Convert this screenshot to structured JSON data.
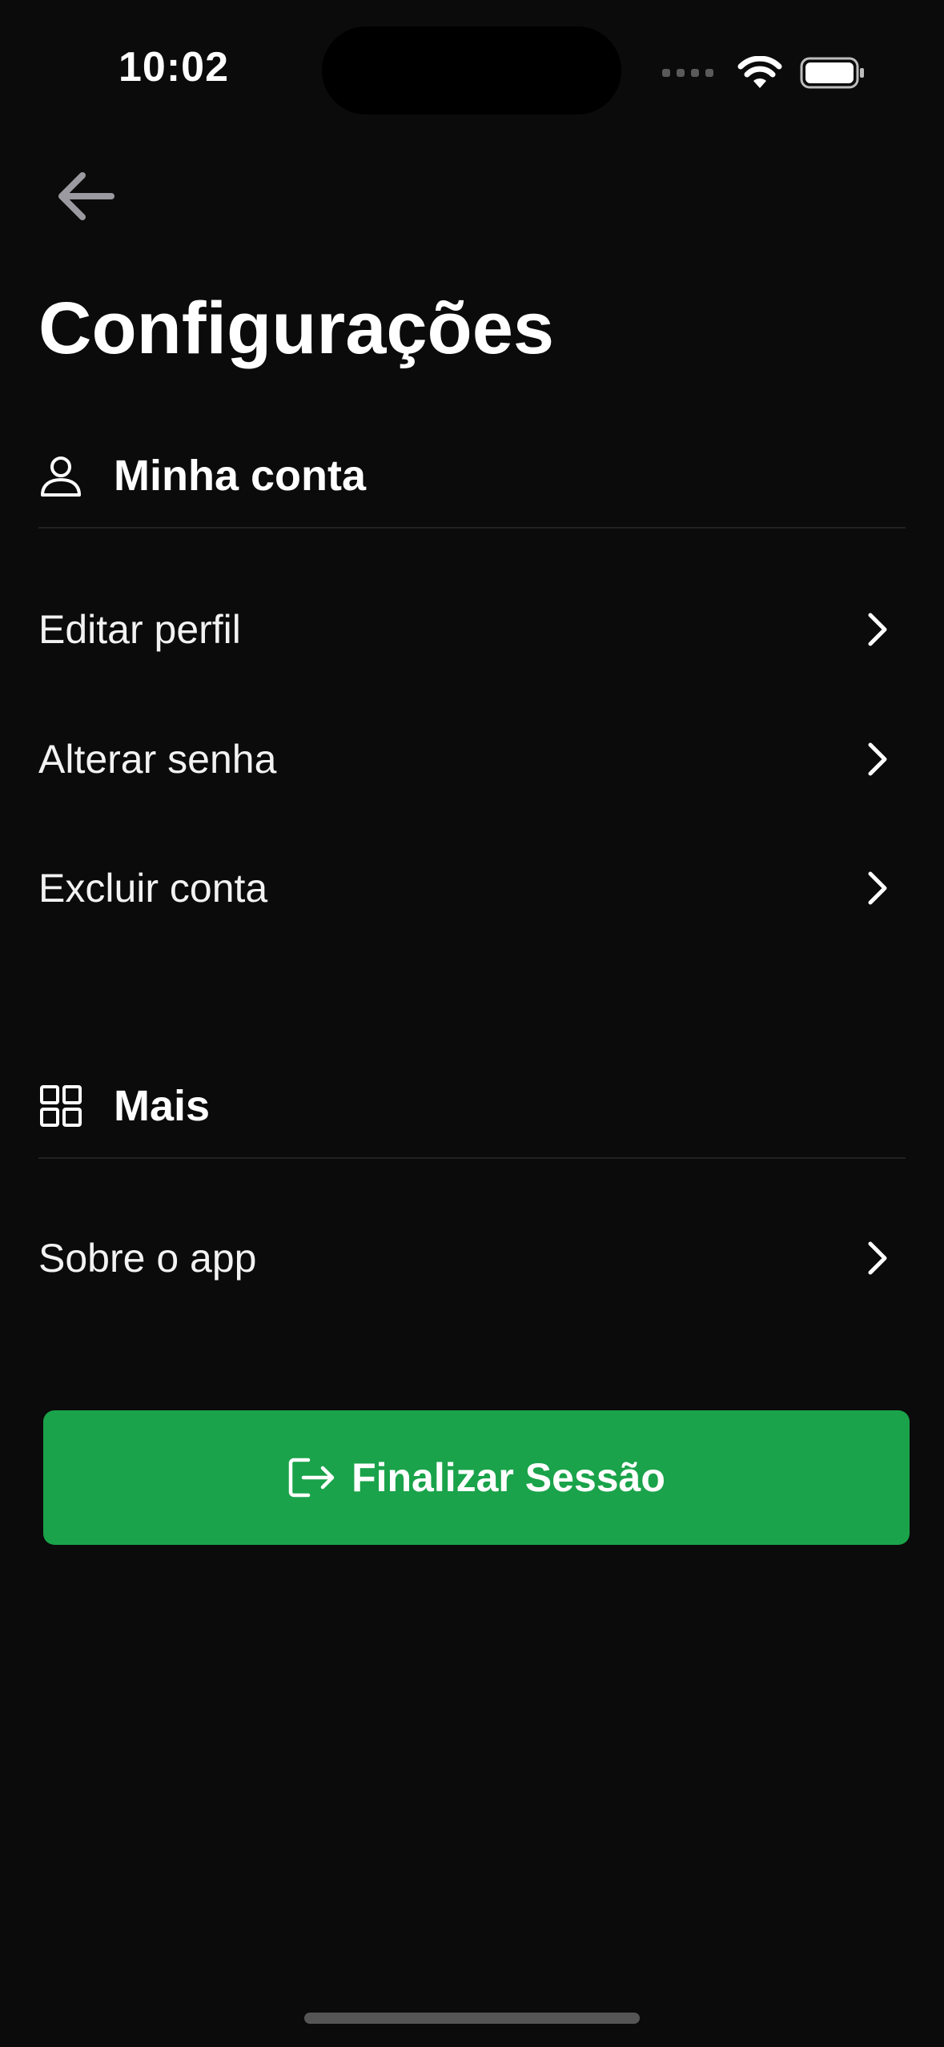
{
  "status_bar": {
    "time": "10:02",
    "icons": [
      "cellular-signal-icon",
      "wifi-icon",
      "battery-icon"
    ]
  },
  "header": {
    "back_icon": "arrow-left-icon",
    "title": "Configurações"
  },
  "sections": [
    {
      "icon": "user-icon",
      "title": "Minha conta",
      "items": [
        {
          "label": "Editar perfil",
          "icon": "chevron-right-icon"
        },
        {
          "label": "Alterar senha",
          "icon": "chevron-right-icon"
        },
        {
          "label": "Excluir conta",
          "icon": "chevron-right-icon"
        }
      ]
    },
    {
      "icon": "grid-icon",
      "title": "Mais",
      "items": [
        {
          "label": "Sobre o app",
          "icon": "chevron-right-icon"
        }
      ]
    }
  ],
  "logout_button": {
    "label": "Finalizar Sessão",
    "icon": "logout-icon",
    "color": "#1aa34a"
  },
  "colors": {
    "background": "#0b0b0b",
    "text": "#ffffff",
    "accent": "#1aa34a",
    "divider": "#222222"
  }
}
